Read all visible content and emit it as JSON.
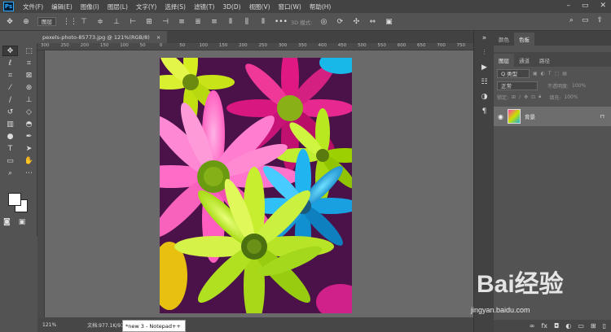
{
  "menu": {
    "logo": "Ps",
    "items": [
      "文件(F)",
      "编辑(E)",
      "图像(I)",
      "图层(L)",
      "文字(Y)",
      "选择(S)",
      "滤镜(T)",
      "3D(D)",
      "视图(V)",
      "窗口(W)",
      "帮助(H)"
    ]
  },
  "options": {
    "layer_select": "图层",
    "mode_label": "3D 模式:"
  },
  "document": {
    "tab_title": "pexels-photo-85773.jpg @ 121%(RGB/8)",
    "close": "×"
  },
  "ruler": {
    "ticks": [
      "300",
      "250",
      "200",
      "150",
      "100",
      "50",
      "0",
      "50",
      "100",
      "150",
      "200",
      "250",
      "300",
      "350",
      "400",
      "450",
      "500",
      "550",
      "600",
      "650",
      "700",
      "750"
    ]
  },
  "status": {
    "zoom": "121%",
    "doc_size": "文档:977.1K/977.1K"
  },
  "taskbar": {
    "notepad": "*new 3 - Notepad++"
  },
  "panels": {
    "top_tabs": [
      "颜色",
      "色板"
    ],
    "layer_tabs": [
      "图层",
      "通道",
      "路径"
    ],
    "kind_filter": "Q 类型",
    "blend_mode": "正常",
    "opacity_label": "不透明度:",
    "opacity_value": "100%",
    "lock_label": "锁定:",
    "fill_label": "填充:",
    "fill_value": "100%",
    "layer_name": "背景"
  },
  "watermark": {
    "brand": "Bai经验",
    "url": "jingyan.baidu.com"
  },
  "colors": {
    "chrome_dark": "#434343",
    "chrome": "#535353",
    "pasteboard": "#6a6a6a"
  }
}
